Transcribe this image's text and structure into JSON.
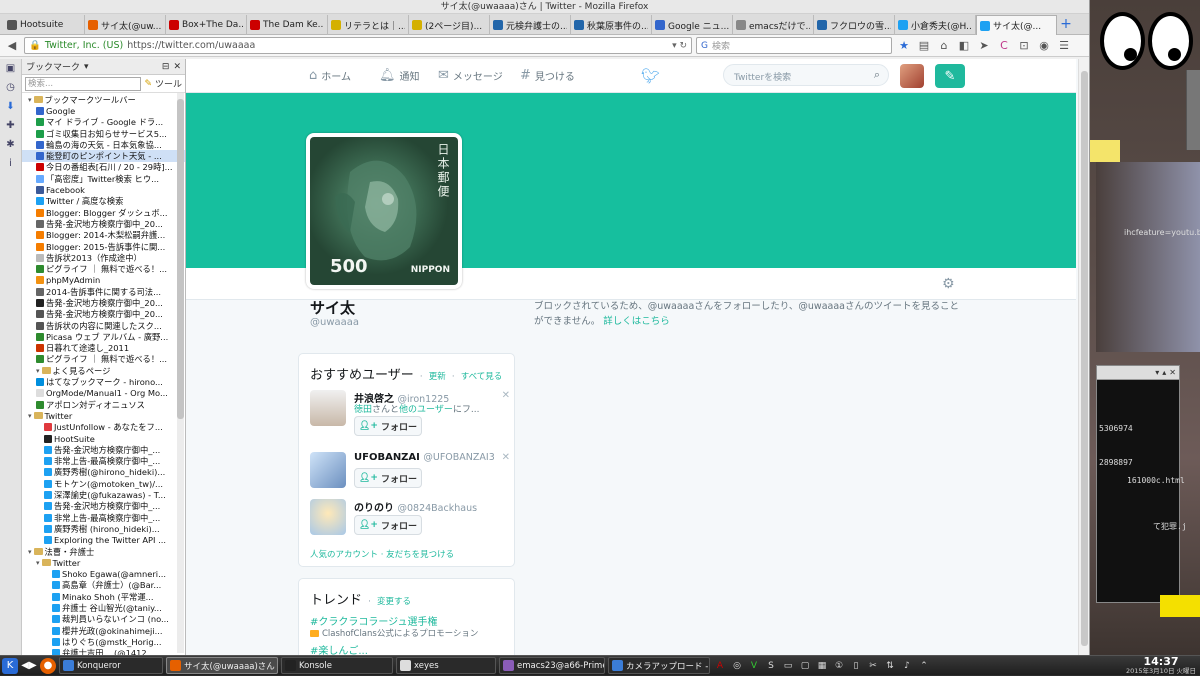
{
  "window": {
    "title": "サイ太(@uwaaaa)さん | Twitter - Mozilla Firefox"
  },
  "tabs": [
    {
      "label": "Hootsuite",
      "color": "#555555"
    },
    {
      "label": "サイ太(@uw...",
      "color": "#e66000"
    },
    {
      "label": "Box+The Da...",
      "color": "#cc0000"
    },
    {
      "label": "The Dam Ke...",
      "color": "#cc0000"
    },
    {
      "label": "リテラとは｜...",
      "color": "#d4b000"
    },
    {
      "label": "(2ページ目)...",
      "color": "#d4b000"
    },
    {
      "label": "元検弁護士の...",
      "color": "#2266aa"
    },
    {
      "label": "秋葉原事件の...",
      "color": "#2266aa"
    },
    {
      "label": "Google ニュ...",
      "color": "#3366cc"
    },
    {
      "label": "emacsだけで...",
      "color": "#888888"
    },
    {
      "label": "フクロウの雪...",
      "color": "#2266aa"
    },
    {
      "label": "小倉秀夫(@H...",
      "color": "#1da1f2"
    },
    {
      "label": "サイ太(@...",
      "color": "#1da1f2",
      "active": true
    }
  ],
  "navbar": {
    "url_owner": "Twitter, Inc. (US)",
    "url": "https://twitter.com/uwaaaa",
    "search_placeholder": "検索"
  },
  "sidebar": {
    "title": "ブックマーク",
    "search_placeholder": "検索...",
    "tools_label": "ツール",
    "items": [
      {
        "label": "ブックマークツールバー",
        "kind": "folder",
        "indent": 0
      },
      {
        "label": "Google",
        "color": "#3366cc",
        "indent": 1
      },
      {
        "label": "マイ ドライブ - Google ドラ...",
        "color": "#1e9e4a",
        "indent": 1
      },
      {
        "label": "ゴミ収集日お知らせサービス5...",
        "color": "#1e9e4a",
        "indent": 1
      },
      {
        "label": "輪島の海の天気 - 日本気象協...",
        "color": "#3366cc",
        "indent": 1
      },
      {
        "label": "能登町のピンポイント天気 - ...",
        "color": "#3366cc",
        "indent": 1,
        "selected": true
      },
      {
        "label": "今日の番組表[石川 / 20 - 29時]...",
        "color": "#cc0000",
        "indent": 1
      },
      {
        "label": "「高密度」Twitter検索 ヒウ...",
        "color": "#66aaff",
        "indent": 1
      },
      {
        "label": "Facebook",
        "color": "#3b5998",
        "indent": 1
      },
      {
        "label": "Twitter / 高度な検索",
        "color": "#1da1f2",
        "indent": 1
      },
      {
        "label": "Blogger: Blogger ダッシュボ...",
        "color": "#f57d00",
        "indent": 1
      },
      {
        "label": "告発-金沢地方検察庁御中_20...",
        "color": "#666666",
        "indent": 1
      },
      {
        "label": "Blogger: 2014-木梨松嗣弁護...",
        "color": "#f57d00",
        "indent": 1
      },
      {
        "label": "Blogger: 2015-告訴事件に関...",
        "color": "#f57d00",
        "indent": 1
      },
      {
        "label": "告訴状2013（作成途中）",
        "color": "#bbbbbb",
        "indent": 1
      },
      {
        "label": "ピグライフ ｜ 無料で遊べる！...",
        "color": "#2e8b2e",
        "indent": 1
      },
      {
        "label": "phpMyAdmin",
        "color": "#f29111",
        "indent": 1
      },
      {
        "label": "2014-告訴事件に関する司法...",
        "color": "#666666",
        "indent": 1
      },
      {
        "label": "告発-金沢地方検察庁御中_20...",
        "color": "#222222",
        "indent": 1
      },
      {
        "label": "告発-金沢地方検察庁御中_20...",
        "color": "#555555",
        "indent": 1
      },
      {
        "label": "告訴状の内容に関連したスク...",
        "color": "#555555",
        "indent": 1
      },
      {
        "label": "Picasa ウェブ アルバム - 廣野...",
        "color": "#2e8b2e",
        "indent": 1
      },
      {
        "label": "日暮れて途遠し_2011",
        "color": "#cc3300",
        "indent": 1
      },
      {
        "label": "ピグライフ ｜ 無料で遊べる！...",
        "color": "#2e8b2e",
        "indent": 1
      },
      {
        "label": "よく見るページ",
        "kind": "folder",
        "indent": 1
      },
      {
        "label": "はてなブックマーク - hirono...",
        "color": "#008fde",
        "indent": 1
      },
      {
        "label": "OrgMode/Manual1 - Org Mo...",
        "color": "#dddddd",
        "indent": 1
      },
      {
        "label": "アポロン対ディオニュソス",
        "color": "#2e8b2e",
        "indent": 1
      },
      {
        "label": "Twitter",
        "kind": "folder",
        "indent": 0
      },
      {
        "label": "JustUnfollow - あなたをフ...",
        "color": "#e0393e",
        "indent": 2
      },
      {
        "label": "HootSuite",
        "color": "#222222",
        "indent": 2
      },
      {
        "label": "告発-金沢地方検察庁御中_...",
        "color": "#1da1f2",
        "indent": 2
      },
      {
        "label": "非常上告-最高検察庁御中_...",
        "color": "#1da1f2",
        "indent": 2
      },
      {
        "label": "廣野秀樹(@hirono_hideki)...",
        "color": "#1da1f2",
        "indent": 2
      },
      {
        "label": "モトケン(@motoken_tw)/...",
        "color": "#1da1f2",
        "indent": 2
      },
      {
        "label": "深澤諭史(@fukazawas) - T...",
        "color": "#1da1f2",
        "indent": 2
      },
      {
        "label": "告発-金沢地方検察庁御中_...",
        "color": "#1da1f2",
        "indent": 2
      },
      {
        "label": "非常上告-最高検察庁御中_...",
        "color": "#1da1f2",
        "indent": 2
      },
      {
        "label": "廣野秀樹 (hirono_hideki)...",
        "color": "#1da1f2",
        "indent": 2
      },
      {
        "label": "Exploring the Twitter API ...",
        "color": "#1da1f2",
        "indent": 2
      },
      {
        "label": "法曹・弁護士",
        "kind": "folder",
        "indent": 0
      },
      {
        "label": "Twitter",
        "kind": "folder",
        "indent": 1
      },
      {
        "label": "Shoko Egawa(@amneri...",
        "color": "#1da1f2",
        "indent": 3
      },
      {
        "label": "高島章（弁護士）(@Bar...",
        "color": "#1da1f2",
        "indent": 3
      },
      {
        "label": "Minako Shoh (平常運...",
        "color": "#1da1f2",
        "indent": 3
      },
      {
        "label": "弁護士 谷山智光(@taniy...",
        "color": "#1da1f2",
        "indent": 3
      },
      {
        "label": "裁判員いらないインコ (no...",
        "color": "#1da1f2",
        "indent": 3
      },
      {
        "label": "櫻井光政(@okinahimeji...",
        "color": "#1da1f2",
        "indent": 3
      },
      {
        "label": "はりぐち(@mstk_Horig...",
        "color": "#1da1f2",
        "indent": 3
      },
      {
        "label": "弁護士吉田... (@1412...",
        "color": "#1da1f2",
        "indent": 3
      }
    ]
  },
  "twitter": {
    "nav": {
      "home": "ホーム",
      "notifications": "通知",
      "messages": "メッセージ",
      "discover": "見つける"
    },
    "search_placeholder": "Twitterを検索",
    "banner_color": "#16bf9e",
    "accent": "#1fb99d",
    "profile": {
      "name": "サイ太",
      "handle": "@uwaaaa",
      "avatar": {
        "country": "日本郵便",
        "value": "500",
        "nippon": "NIPPON"
      }
    },
    "blocked": {
      "message": "ブロックされているため、@uwaaaaさんをフォローしたり、@uwaaaaさんのツイートを見ることができません。",
      "link": "詳しくはこちら"
    },
    "who_to_follow": {
      "title": "おすすめユーザー",
      "refresh": "更新",
      "view_all": "すべて見る",
      "separator": "·",
      "follow_label": "フォロー",
      "suggestions": [
        {
          "name": "井浪啓之",
          "handle": "@iron1225",
          "context_user": "徳田",
          "context_mid": "さんと",
          "context_link": "他のユーザー",
          "context_end": "にフ..."
        },
        {
          "name": "UFOBANZAI",
          "handle": "@UFOBANZAI3"
        },
        {
          "name": "のりのり",
          "handle": "@0824Backhaus"
        }
      ],
      "footer": "人気のアカウント · 友だちを見つける"
    },
    "trends": {
      "title": "トレンド",
      "change": "変更する",
      "items": [
        {
          "tag": "#クラクラコラージュ選手権",
          "promo": "ClashofClans公式によるプロモーション"
        },
        {
          "tag": "#楽しんご..."
        }
      ]
    }
  },
  "desktop": {
    "url_fragment": "ihcfeature=youtu.be",
    "terminal_lines": [
      "5306974",
      "2898897",
      "161000c.html",
      "て犯罪.j"
    ]
  },
  "taskbar": {
    "tasks": [
      {
        "label": "Konqueror",
        "color": "#3b7dd8"
      },
      {
        "label": "サイ太(@uwaaaa)さん | Tw...",
        "color": "#e66000",
        "active": true
      },
      {
        "label": "Konsole",
        "color": "#222222"
      },
      {
        "label": "xeyes",
        "color": "#dddddd"
      },
      {
        "label": "emacs23@a66-Prime-Seri...",
        "color": "#8a5cb8"
      },
      {
        "label": "カメラアップロード - Dolp...",
        "color": "#3b7dd8"
      }
    ],
    "clock_time": "14:37",
    "clock_date": "2015年3月10日 火曜日"
  }
}
